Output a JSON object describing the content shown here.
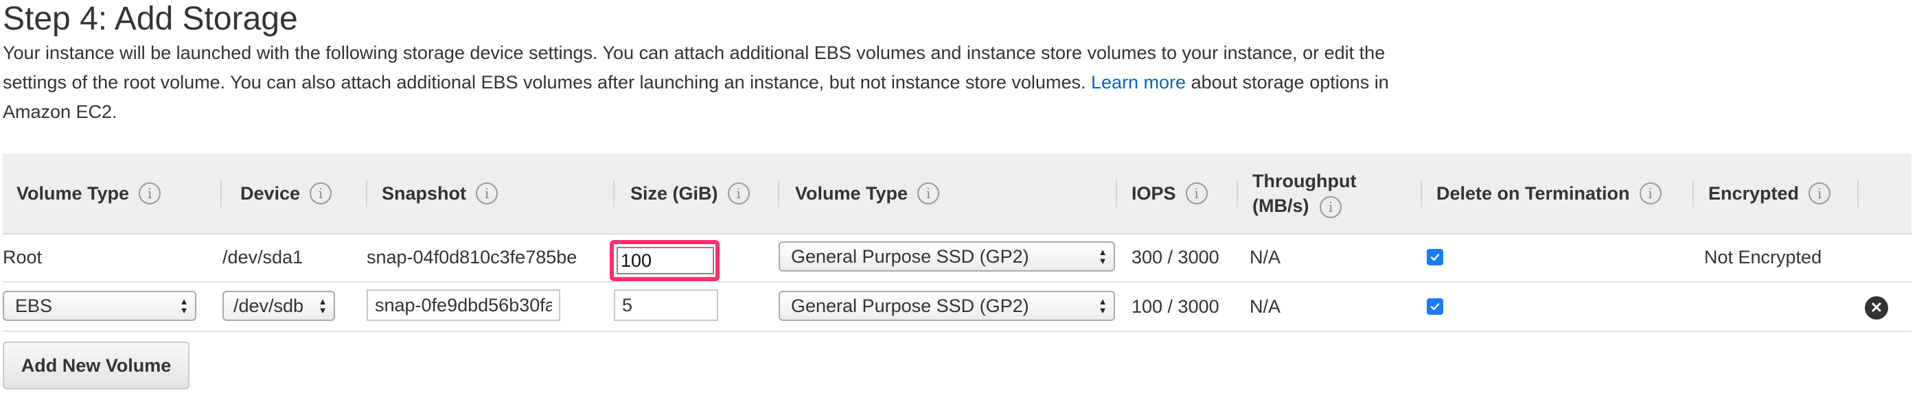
{
  "header": {
    "title": "Step 4: Add Storage",
    "description_part1": "Your instance will be launched with the following storage device settings. You can attach additional EBS volumes and instance store volumes to your instance, or edit the settings of the root volume. You can also attach additional EBS volumes after launching an instance, but not instance store volumes.",
    "learn_more": "Learn more",
    "description_part2": "about storage options in Amazon EC2."
  },
  "table": {
    "columns": {
      "volume_type": "Volume Type",
      "device": "Device",
      "snapshot": "Snapshot",
      "size": "Size (GiB)",
      "volume_type2": "Volume Type",
      "iops": "IOPS",
      "throughput_line1": "Throughput",
      "throughput_line2": "(MB/s)",
      "delete_on_termination": "Delete on Termination",
      "encrypted": "Encrypted"
    },
    "info_glyph": "i",
    "rows": [
      {
        "volume_type": "Root",
        "device": "/dev/sda1",
        "snapshot": "snap-04f0d810c3fe785be",
        "size": "100",
        "ebs_volume_type": "General Purpose SSD (GP2)",
        "iops": "300 / 3000",
        "throughput": "N/A",
        "delete_on_termination": true,
        "encrypted": "Not Encrypted"
      },
      {
        "volume_type": "EBS",
        "device": "/dev/sdb",
        "snapshot": "snap-0fe9dbd56b30fa",
        "size": "5",
        "ebs_volume_type": "General Purpose SSD (GP2)",
        "iops": "100 / 3000",
        "throughput": "N/A",
        "delete_on_termination": true,
        "encrypted": ""
      }
    ]
  },
  "actions": {
    "add_new_volume": "Add New Volume"
  },
  "colors": {
    "link": "#0066cc",
    "highlight": "#ff2f6d",
    "checkbox": "#1a7cf4",
    "header_bg": "#eeeeee"
  },
  "icons": {
    "info": "info-icon",
    "remove": "remove-volume-icon",
    "select_arrows": "select-arrows-icon",
    "checkmark": "checkmark-icon"
  }
}
